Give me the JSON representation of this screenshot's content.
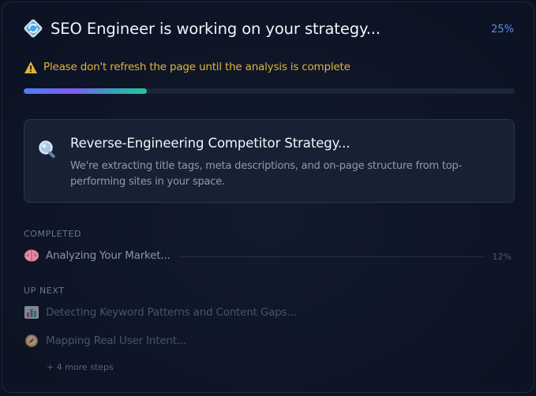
{
  "header": {
    "title": "SEO Engineer is working on your strategy...",
    "percent": "25%",
    "icon": "spinning-diamond-icon"
  },
  "warning": {
    "icon": "warning-triangle-icon",
    "text": "Please don't refresh the page until the analysis is complete",
    "color": "#e2b33a"
  },
  "progress": {
    "value": 0.25
  },
  "current_step": {
    "icon": "magnifier-icon",
    "title": "Reverse-Engineering Competitor Strategy...",
    "description": "We're extracting title tags, meta descriptions, and on-page structure from top-performing sites in your space."
  },
  "completed": {
    "label": "COMPLETED",
    "steps": [
      {
        "icon": "brain-icon",
        "label": "Analyzing Your Market...",
        "percent": "12%"
      }
    ]
  },
  "up_next": {
    "label": "UP NEXT",
    "steps": [
      {
        "icon": "bar-chart-icon",
        "label": "Detecting Keyword Patterns and Content Gaps..."
      },
      {
        "icon": "compass-icon",
        "label": "Mapping Real User Intent..."
      }
    ],
    "more": "+ 4 more steps"
  },
  "colors": {
    "background": "#0b1222",
    "accent": "#5b8def",
    "card": "#172133"
  }
}
